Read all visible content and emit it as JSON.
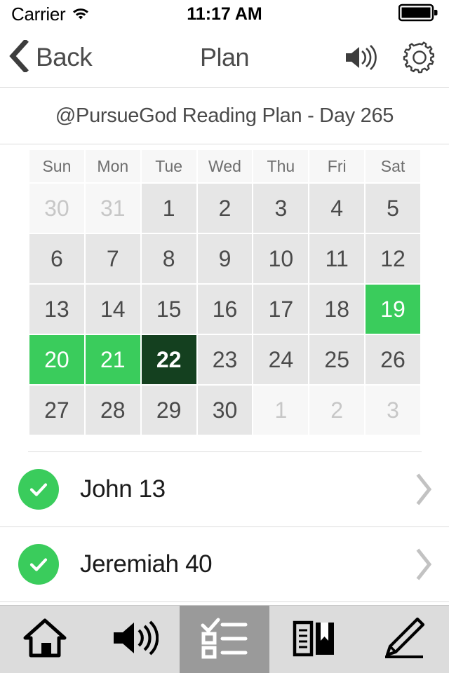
{
  "status_bar": {
    "carrier": "Carrier",
    "wifi_icon": "wifi-icon",
    "time": "11:17 AM",
    "battery_icon": "battery-full-icon"
  },
  "nav_bar": {
    "back_label": "Back",
    "back_icon": "chevron-left-icon",
    "title": "Plan",
    "audio_icon": "speaker-icon",
    "settings_icon": "gear-icon"
  },
  "plan_header": {
    "title": "@PursueGod Reading Plan - Day 265"
  },
  "calendar": {
    "weekdays": [
      "Sun",
      "Mon",
      "Tue",
      "Wed",
      "Thu",
      "Fri",
      "Sat"
    ],
    "colors": {
      "default_cell": "#e6e6e6",
      "muted_cell": "#f7f7f7",
      "read_cell": "#3ACC5C",
      "today_cell": "#14401F",
      "header_cell": "#f7f7f7"
    },
    "weeks": [
      [
        {
          "day": "30",
          "state": "muted"
        },
        {
          "day": "31",
          "state": "muted"
        },
        {
          "day": "1",
          "state": "default"
        },
        {
          "day": "2",
          "state": "default"
        },
        {
          "day": "3",
          "state": "default"
        },
        {
          "day": "4",
          "state": "default"
        },
        {
          "day": "5",
          "state": "default"
        }
      ],
      [
        {
          "day": "6",
          "state": "default"
        },
        {
          "day": "7",
          "state": "default"
        },
        {
          "day": "8",
          "state": "default"
        },
        {
          "day": "9",
          "state": "default"
        },
        {
          "day": "10",
          "state": "default"
        },
        {
          "day": "11",
          "state": "default"
        },
        {
          "day": "12",
          "state": "default"
        }
      ],
      [
        {
          "day": "13",
          "state": "default"
        },
        {
          "day": "14",
          "state": "default"
        },
        {
          "day": "15",
          "state": "default"
        },
        {
          "day": "16",
          "state": "default"
        },
        {
          "day": "17",
          "state": "default"
        },
        {
          "day": "18",
          "state": "default"
        },
        {
          "day": "19",
          "state": "read"
        }
      ],
      [
        {
          "day": "20",
          "state": "read"
        },
        {
          "day": "21",
          "state": "read"
        },
        {
          "day": "22",
          "state": "today"
        },
        {
          "day": "23",
          "state": "default"
        },
        {
          "day": "24",
          "state": "default"
        },
        {
          "day": "25",
          "state": "default"
        },
        {
          "day": "26",
          "state": "default"
        }
      ],
      [
        {
          "day": "27",
          "state": "default"
        },
        {
          "day": "28",
          "state": "default"
        },
        {
          "day": "29",
          "state": "default"
        },
        {
          "day": "30",
          "state": "default"
        },
        {
          "day": "1",
          "state": "muted"
        },
        {
          "day": "2",
          "state": "muted"
        },
        {
          "day": "3",
          "state": "muted"
        }
      ]
    ]
  },
  "readings": [
    {
      "label": "John 13",
      "completed": true,
      "check_icon": "check-circle-icon",
      "chevron_icon": "chevron-right-icon"
    },
    {
      "label": "Jeremiah 40",
      "completed": true,
      "check_icon": "check-circle-icon",
      "chevron_icon": "chevron-right-icon"
    }
  ],
  "tab_bar": {
    "active_index": 2,
    "items": [
      {
        "icon": "home-icon",
        "name": "tab-home"
      },
      {
        "icon": "speaker-icon",
        "name": "tab-audio"
      },
      {
        "icon": "checklist-icon",
        "name": "tab-plan"
      },
      {
        "icon": "book-icon",
        "name": "tab-bible"
      },
      {
        "icon": "pencil-icon",
        "name": "tab-notes"
      }
    ]
  }
}
